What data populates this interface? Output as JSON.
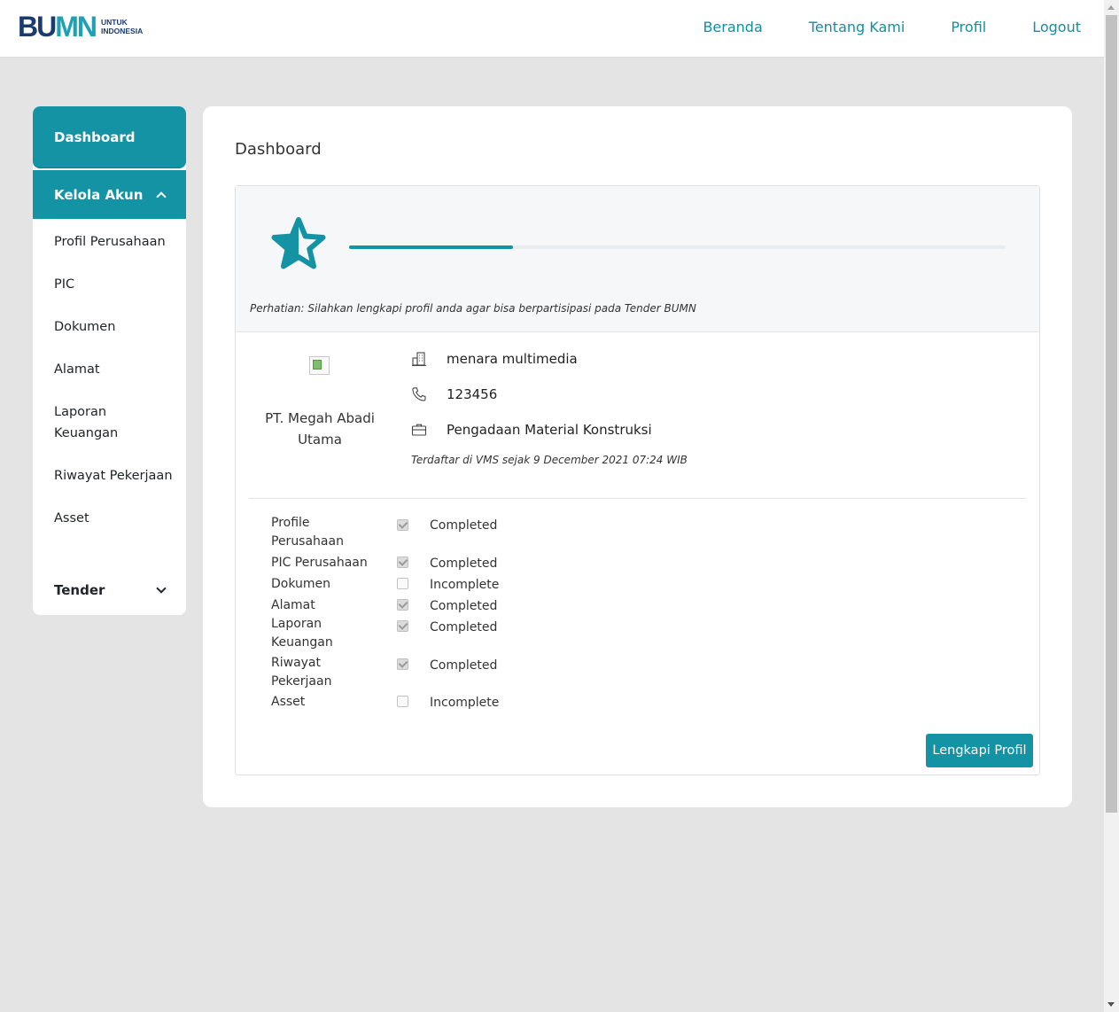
{
  "brand": {
    "logo_b": "B",
    "logo_u": "U",
    "logo_mn": "MN",
    "logo_line1": "UNTUK",
    "logo_line2": "INDONESIA"
  },
  "nav": {
    "items": [
      "Beranda",
      "Tentang Kami",
      "Profil",
      "Logout"
    ]
  },
  "sidebar": {
    "dashboard": "Dashboard",
    "kelola_akun": "Kelola Akun",
    "items": [
      "Profil Perusahaan",
      "PIC",
      "Dokumen",
      "Alamat",
      "Laporan Keuangan",
      "Riwayat Pekerjaan",
      "Asset"
    ],
    "tender": "Tender"
  },
  "main": {
    "title": "Dashboard",
    "progress_fraction": 0.25,
    "notice": "Perhatian: Silahkan lengkapi profil anda agar bisa berpartisipasi pada Tender BUMN",
    "company_name": "PT. Megah Abadi Utama",
    "building": "menara multimedia",
    "phone": "123456",
    "category": "Pengadaan Material Konstruksi",
    "registered": "Terdaftar di VMS sejak 9 December 2021 07:24 WIB",
    "status": [
      {
        "label": "Profile Perusahaan",
        "checked": true,
        "value": "Completed"
      },
      {
        "label": "PIC Perusahaan",
        "checked": true,
        "value": "Completed"
      },
      {
        "label": "Dokumen",
        "checked": false,
        "value": "Incomplete"
      },
      {
        "label": "Alamat",
        "checked": true,
        "value": "Completed"
      },
      {
        "label": "Laporan Keuangan",
        "checked": true,
        "value": "Completed"
      },
      {
        "label": "Riwayat Pekerjaan",
        "checked": true,
        "value": "Completed"
      },
      {
        "label": "Asset",
        "checked": false,
        "value": "Incomplete"
      }
    ],
    "button": "Lengkapi Profil"
  },
  "colors": {
    "accent": "#1493a4",
    "nav_link": "#138ea0",
    "brand_dark": "#1a3b6e"
  },
  "icons": [
    "star-icon",
    "building-icon",
    "phone-icon",
    "briefcase-icon",
    "chevron-up-icon",
    "chevron-down-icon"
  ]
}
